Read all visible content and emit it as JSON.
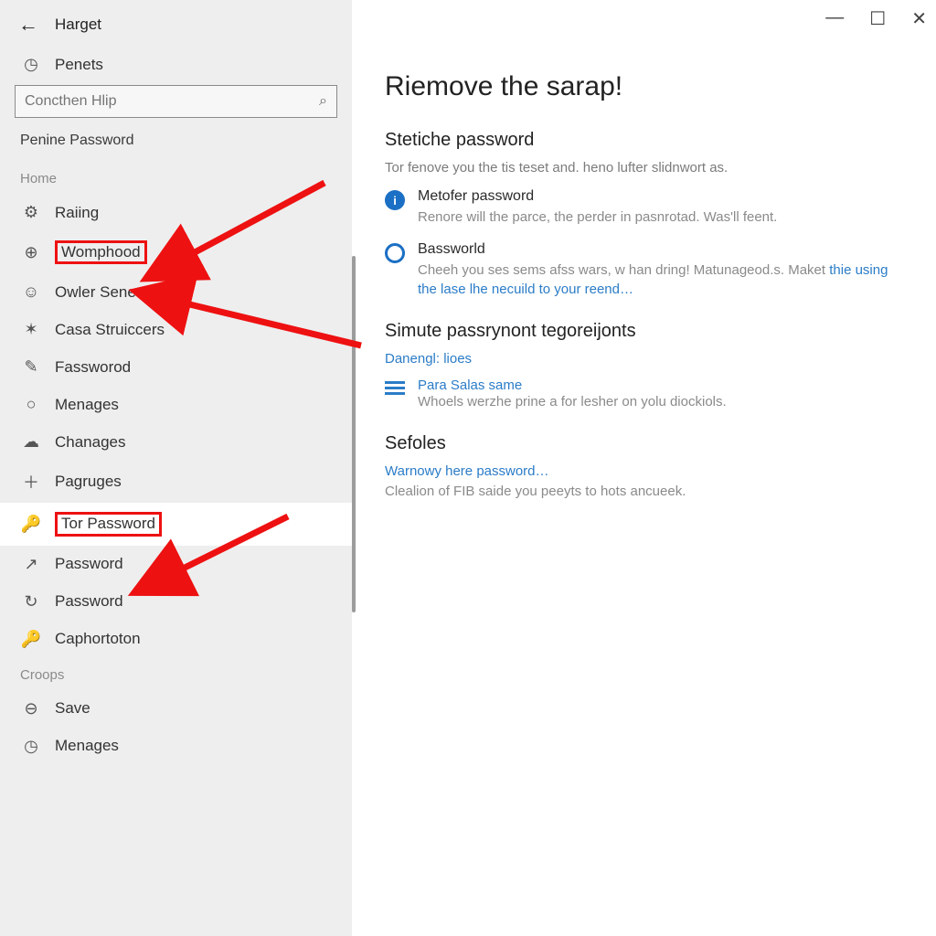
{
  "header": {
    "app_title": "Harget"
  },
  "sidebar": {
    "quick_label": "Penets",
    "search_placeholder": "Concthen Hlip",
    "subtitle": "Penine Password",
    "section1_label": "Home",
    "items1": [
      {
        "icon": "⚙",
        "label": "Raiing"
      },
      {
        "icon": "⊕",
        "label": "Womphood"
      },
      {
        "icon": "☺",
        "label": "Owler Senes"
      },
      {
        "icon": "✶",
        "label": "Casa Struiccers"
      },
      {
        "icon": "✎",
        "label": "Fassworod"
      },
      {
        "icon": "○",
        "label": "Menages"
      },
      {
        "icon": "☁",
        "label": "Chanages"
      },
      {
        "icon": "＋",
        "label": "Pagruges"
      },
      {
        "icon": "🔑",
        "label": "Tor Password"
      },
      {
        "icon": "↗",
        "label": "Password"
      },
      {
        "icon": "↻",
        "label": "Password"
      },
      {
        "icon": "🔑",
        "label": "Caphortoton"
      }
    ],
    "section2_label": "Croops",
    "items2": [
      {
        "icon": "⊖",
        "label": "Save"
      },
      {
        "icon": "◷",
        "label": "Menages"
      }
    ]
  },
  "main": {
    "title": "Riemove the sarap!",
    "s1_title": "Stetiche password",
    "s1_desc": "Tor fenove you the tis teset and. heno lufter slidnwort as.",
    "bullets": [
      {
        "title": "Metofer password",
        "desc": "Renore will the parce, the perder in pasnrotad. Was'll feent."
      },
      {
        "title": "Bassworld",
        "desc": "Cheeh you ses sems afss wars, w han dring! Matunageod.s. Maket ",
        "link": "thie using the lase lhe necuild to your reend…"
      }
    ],
    "s2_title": "Simute passrynont tegoreijonts",
    "s2_link": "Danengl: lioes",
    "s2_item_title": "Para Salas same",
    "s2_item_desc": "Whoels werzhe prine a for lesher on yolu diockiols.",
    "s3_title": "Sefoles",
    "s3_link": "Warnowy here password…",
    "s3_desc": "Clealion of FIB saide you peeyts to hots ancueek."
  }
}
